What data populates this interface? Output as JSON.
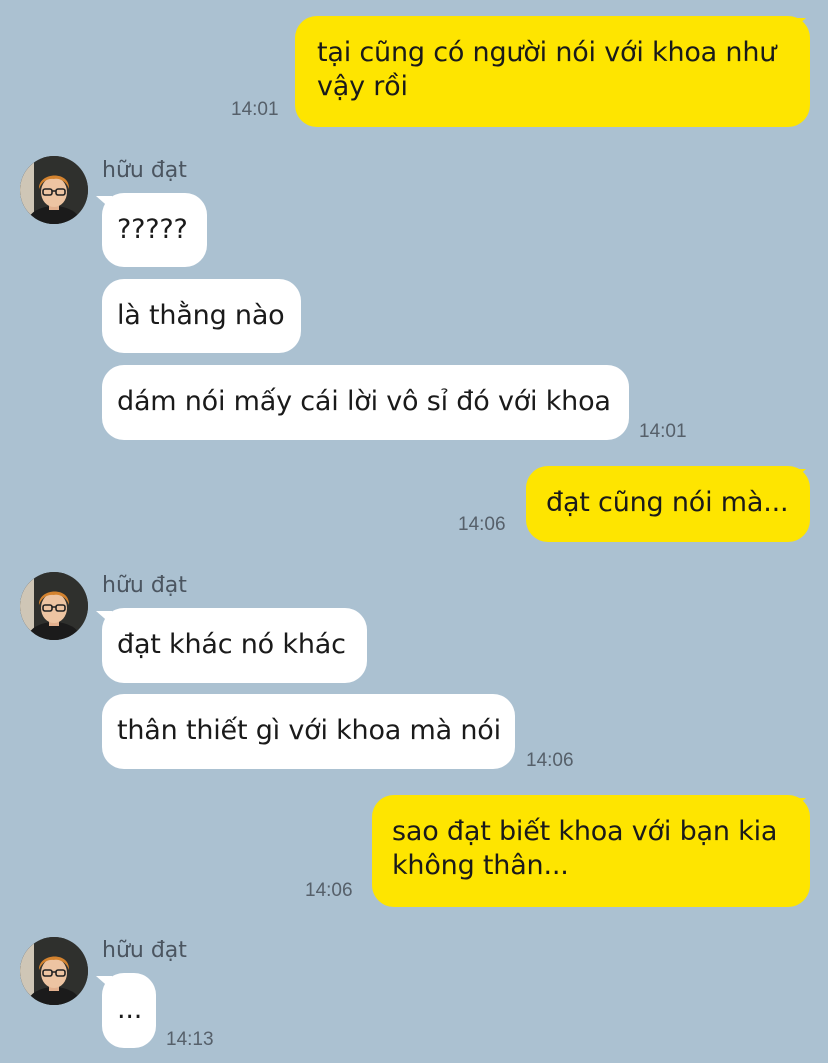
{
  "chat": {
    "contact_name": "hữu đạt",
    "colors": {
      "background": "#abc1d1",
      "my_bubble": "#fee500",
      "their_bubble": "#ffffff"
    },
    "messages": [
      {
        "from": "me",
        "text_lines": [
          "tại cũng có người nói với khoa như",
          "vậy rồi"
        ],
        "time": "14:01"
      },
      {
        "from": "them",
        "text": "?????"
      },
      {
        "from": "them",
        "text": "là thằng nào"
      },
      {
        "from": "them",
        "text": "dám nói mấy cái lời vô sỉ đó với khoa",
        "time": "14:01"
      },
      {
        "from": "me",
        "text": "đạt cũng nói mà...",
        "time": "14:06"
      },
      {
        "from": "them",
        "text": "đạt khác nó khác"
      },
      {
        "from": "them",
        "text": "thân thiết gì với khoa mà nói",
        "time": "14:06"
      },
      {
        "from": "me",
        "text_lines": [
          "sao đạt biết khoa với bạn kia",
          "không thân..."
        ],
        "time": "14:06"
      },
      {
        "from": "them",
        "text": "...",
        "time": "14:13"
      }
    ],
    "avatar_icon": "user-photo-avatar"
  }
}
